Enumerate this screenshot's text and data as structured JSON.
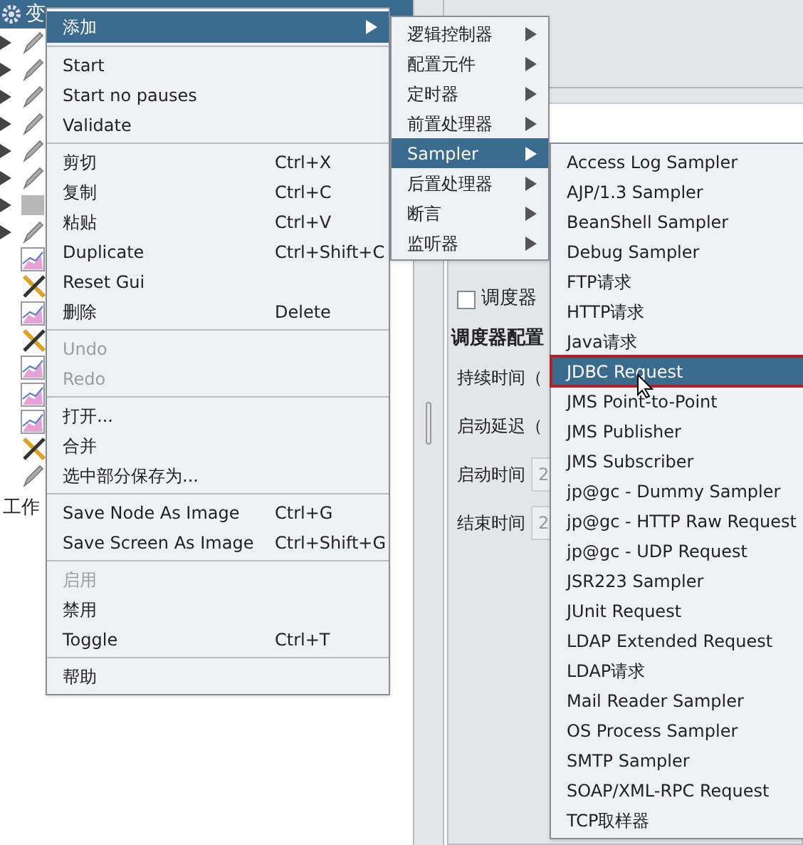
{
  "tree": {
    "root": {
      "label": "变",
      "selected": true
    },
    "nodes": [
      {
        "kind": "pencil",
        "expandable": true
      },
      {
        "kind": "pencil",
        "expandable": true
      },
      {
        "kind": "pencil",
        "expandable": true
      },
      {
        "kind": "pencil",
        "expandable": true
      },
      {
        "kind": "pencil",
        "expandable": true
      },
      {
        "kind": "pencil",
        "expandable": true
      },
      {
        "kind": "block",
        "expandable": true
      },
      {
        "kind": "pencil",
        "expandable": true
      },
      {
        "kind": "chart",
        "expandable": false
      },
      {
        "kind": "tools",
        "expandable": false
      },
      {
        "kind": "chart",
        "expandable": false
      },
      {
        "kind": "tools",
        "expandable": false
      },
      {
        "kind": "chart",
        "expandable": false
      },
      {
        "kind": "chart",
        "expandable": false
      },
      {
        "kind": "chart",
        "expandable": false
      },
      {
        "kind": "tools",
        "expandable": false
      },
      {
        "kind": "pencil",
        "expandable": false
      }
    ],
    "workbench": "工作"
  },
  "form": {
    "checkbox": {
      "label": "调度器",
      "checked": false
    },
    "section_title": "调度器配置",
    "rows": [
      {
        "label": "持续时间（"
      },
      {
        "label": "启动延迟（"
      },
      {
        "label": "启动时间",
        "value": "2"
      },
      {
        "label": "结束时间",
        "value": "2"
      }
    ]
  },
  "context_menu": [
    {
      "kind": "item",
      "label": "添加",
      "submenu": true,
      "selected": true,
      "disabled": false
    },
    {
      "kind": "separator"
    },
    {
      "kind": "item",
      "label": "Start",
      "disabled": false,
      "selected": false
    },
    {
      "kind": "item",
      "label": "Start no pauses",
      "disabled": false,
      "selected": false
    },
    {
      "kind": "item",
      "label": "Validate",
      "disabled": false,
      "selected": false
    },
    {
      "kind": "separator"
    },
    {
      "kind": "item",
      "label": "剪切",
      "shortcut": "Ctrl+X",
      "disabled": false,
      "selected": false
    },
    {
      "kind": "item",
      "label": "复制",
      "shortcut": "Ctrl+C",
      "disabled": false,
      "selected": false
    },
    {
      "kind": "item",
      "label": "粘贴",
      "shortcut": "Ctrl+V",
      "disabled": false,
      "selected": false
    },
    {
      "kind": "item",
      "label": "Duplicate",
      "shortcut": "Ctrl+Shift+C",
      "disabled": false,
      "selected": false
    },
    {
      "kind": "item",
      "label": "Reset Gui",
      "disabled": false,
      "selected": false
    },
    {
      "kind": "item",
      "label": "删除",
      "shortcut": "Delete",
      "disabled": false,
      "selected": false
    },
    {
      "kind": "separator"
    },
    {
      "kind": "item",
      "label": "Undo",
      "disabled": true,
      "selected": false
    },
    {
      "kind": "item",
      "label": "Redo",
      "disabled": true,
      "selected": false
    },
    {
      "kind": "separator"
    },
    {
      "kind": "item",
      "label": "打开...",
      "disabled": false,
      "selected": false
    },
    {
      "kind": "item",
      "label": "合并",
      "disabled": false,
      "selected": false
    },
    {
      "kind": "item",
      "label": "选中部分保存为...",
      "disabled": false,
      "selected": false
    },
    {
      "kind": "separator"
    },
    {
      "kind": "item",
      "label": "Save Node As Image",
      "shortcut": "Ctrl+G",
      "disabled": false,
      "selected": false
    },
    {
      "kind": "item",
      "label": "Save Screen As Image",
      "shortcut": "Ctrl+Shift+G",
      "disabled": false,
      "selected": false
    },
    {
      "kind": "separator"
    },
    {
      "kind": "item",
      "label": "启用",
      "disabled": true,
      "selected": false
    },
    {
      "kind": "item",
      "label": "禁用",
      "disabled": false,
      "selected": false
    },
    {
      "kind": "item",
      "label": "Toggle",
      "shortcut": "Ctrl+T",
      "disabled": false,
      "selected": false
    },
    {
      "kind": "separator"
    },
    {
      "kind": "item",
      "label": "帮助",
      "disabled": false,
      "selected": false
    }
  ],
  "add_submenu": [
    {
      "label": "逻辑控制器",
      "selected": false
    },
    {
      "label": "配置元件",
      "selected": false
    },
    {
      "label": "定时器",
      "selected": false
    },
    {
      "label": "前置处理器",
      "selected": false
    },
    {
      "label": "Sampler",
      "selected": true
    },
    {
      "label": "后置处理器",
      "selected": false
    },
    {
      "label": "断言",
      "selected": false
    },
    {
      "label": "监听器",
      "selected": false
    }
  ],
  "sampler_submenu": [
    {
      "label": "Access Log Sampler",
      "selected": false
    },
    {
      "label": "AJP/1.3 Sampler",
      "selected": false
    },
    {
      "label": "BeanShell Sampler",
      "selected": false
    },
    {
      "label": "Debug Sampler",
      "selected": false
    },
    {
      "label": "FTP请求",
      "selected": false
    },
    {
      "label": "HTTP请求",
      "selected": false
    },
    {
      "label": "Java请求",
      "selected": false
    },
    {
      "label": "JDBC Request",
      "selected": true
    },
    {
      "label": "JMS Point-to-Point",
      "selected": false
    },
    {
      "label": "JMS Publisher",
      "selected": false
    },
    {
      "label": "JMS Subscriber",
      "selected": false
    },
    {
      "label": "jp@gc - Dummy Sampler",
      "selected": false
    },
    {
      "label": "jp@gc - HTTP Raw Request",
      "selected": false
    },
    {
      "label": "jp@gc - UDP Request",
      "selected": false
    },
    {
      "label": "JSR223 Sampler",
      "selected": false
    },
    {
      "label": "JUnit Request",
      "selected": false
    },
    {
      "label": "LDAP Extended Request",
      "selected": false
    },
    {
      "label": "LDAP请求",
      "selected": false
    },
    {
      "label": "Mail Reader Sampler",
      "selected": false
    },
    {
      "label": "OS Process Sampler",
      "selected": false
    },
    {
      "label": "SMTP Sampler",
      "selected": false
    },
    {
      "label": "SOAP/XML-RPC Request",
      "selected": false
    },
    {
      "label": "TCP取样器",
      "selected": false
    }
  ]
}
